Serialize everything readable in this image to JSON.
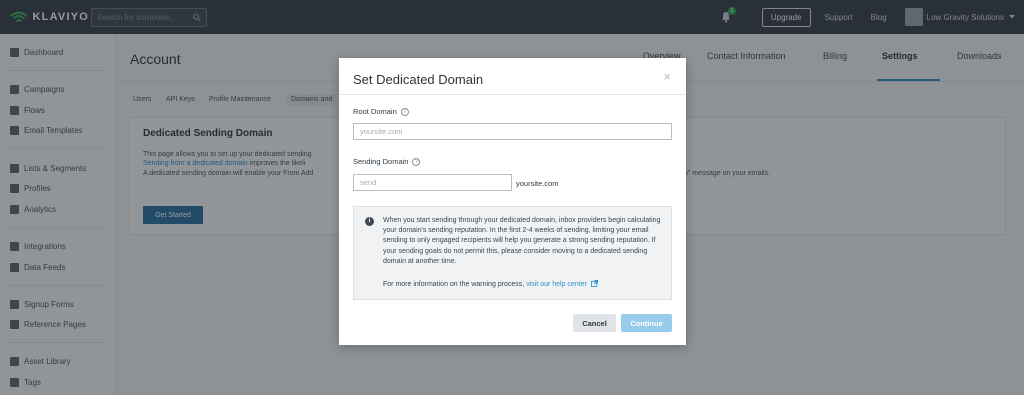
{
  "topbar": {
    "logo_text": "KLAVIYO",
    "search_placeholder": "Search for someone...",
    "notification_count": "1",
    "upgrade_label": "Upgrade",
    "support_label": "Support",
    "blog_label": "Blog",
    "account_name": "Low Gravity Solutions"
  },
  "sidebar": {
    "items": [
      {
        "label": "Dashboard",
        "icon": "dashboard-icon"
      },
      {
        "label": "Campaigns",
        "icon": "campaigns-icon"
      },
      {
        "label": "Flows",
        "icon": "flows-icon"
      },
      {
        "label": "Email Templates",
        "icon": "email-templates-icon"
      },
      {
        "label": "Lists & Segments",
        "icon": "lists-icon"
      },
      {
        "label": "Profiles",
        "icon": "profiles-icon"
      },
      {
        "label": "Analytics",
        "icon": "analytics-icon"
      },
      {
        "label": "Integrations",
        "icon": "integrations-icon"
      },
      {
        "label": "Data Feeds",
        "icon": "data-feeds-icon"
      },
      {
        "label": "Signup Forms",
        "icon": "signup-forms-icon"
      },
      {
        "label": "Reference Pages",
        "icon": "reference-pages-icon"
      },
      {
        "label": "Asset Library",
        "icon": "asset-library-icon"
      },
      {
        "label": "Tags",
        "icon": "tags-icon"
      }
    ]
  },
  "main": {
    "title": "Account",
    "tabs": [
      {
        "label": "Overview"
      },
      {
        "label": "Contact Information"
      },
      {
        "label": "Billing"
      },
      {
        "label": "Settings"
      },
      {
        "label": "Downloads"
      }
    ],
    "subtabs": [
      {
        "label": "Users"
      },
      {
        "label": "API Keys"
      },
      {
        "label": "Profile Maintenance"
      },
      {
        "label": "Domains and"
      }
    ],
    "card": {
      "title": "Dedicated Sending Domain",
      "line1": "This page allows you to set up your dedicated sending",
      "line2_link": "Sending from a dedicated domain",
      "line2_rest": " improves the likeli",
      "line3": "A dedicated sending domain will enable your From Add",
      "line3_right": "on\" message on your emails.",
      "button_label": "Get Started"
    }
  },
  "modal": {
    "title": "Set Dedicated Domain",
    "close_glyph": "×",
    "root_domain_label": "Root Domain",
    "root_domain_placeholder": "yoursite.com",
    "sending_domain_label": "Sending Domain",
    "sending_domain_placeholder": "send",
    "sending_domain_suffix": "yoursite.com",
    "info_text": "When you start sending through your dedicated domain, inbox providers begin calculating your domain's sending reputation. In the first 2-4 weeks of sending, limiting your email sending to only engaged recipients will help you generate a strong sending reputation. If your sending goals do not permit this, please consider moving to a dedicated sending domain at another time.",
    "info_more_prefix": "For more information on the warning process, ",
    "info_more_link": "visit our help center",
    "cancel_label": "Cancel",
    "continue_label": "Continue"
  },
  "colors": {
    "topbar": "#373f47",
    "accent": "#2e8ec9",
    "continue_button": "#96cbea",
    "get_started_button": "#2a6f9e"
  }
}
